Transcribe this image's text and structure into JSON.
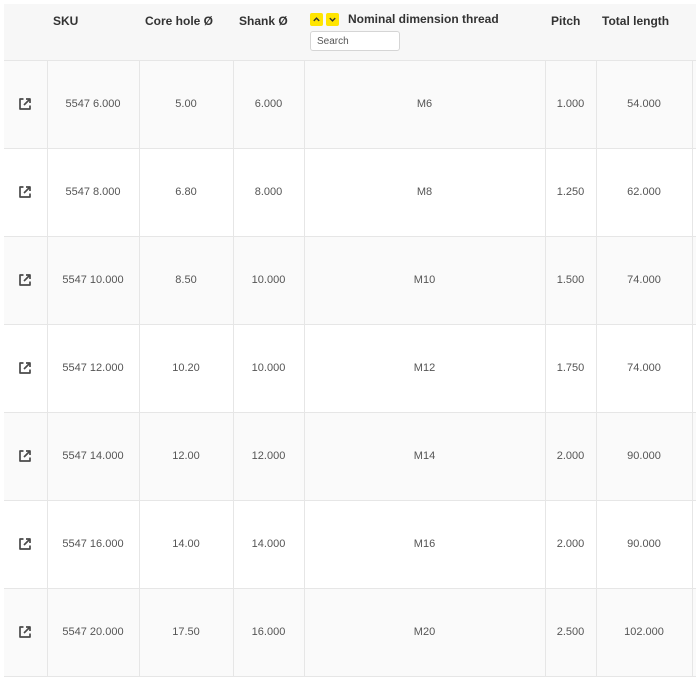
{
  "table": {
    "headers": {
      "sku": "SKU",
      "core_hole": "Core hole Ø",
      "shank": "Shank Ø",
      "nominal": "Nominal dimension thread",
      "pitch": "Pitch",
      "total_length": "Total length"
    },
    "sort_up_icon": "chevron-up-icon",
    "sort_down_icon": "chevron-down-icon",
    "sort_button_color": "#ffe500",
    "search_placeholder": "Search",
    "row_link_icon": "external-link-icon",
    "rows": [
      {
        "sku": "5547 6.000",
        "core_hole": "5.00",
        "shank": "6.000",
        "nominal": "M6",
        "pitch": "1.000",
        "total_length": "54.000"
      },
      {
        "sku": "5547 8.000",
        "core_hole": "6.80",
        "shank": "8.000",
        "nominal": "M8",
        "pitch": "1.250",
        "total_length": "62.000"
      },
      {
        "sku": "5547 10.000",
        "core_hole": "8.50",
        "shank": "10.000",
        "nominal": "M10",
        "pitch": "1.500",
        "total_length": "74.000"
      },
      {
        "sku": "5547 12.000",
        "core_hole": "10.20",
        "shank": "10.000",
        "nominal": "M12",
        "pitch": "1.750",
        "total_length": "74.000"
      },
      {
        "sku": "5547 14.000",
        "core_hole": "12.00",
        "shank": "12.000",
        "nominal": "M14",
        "pitch": "2.000",
        "total_length": "90.000"
      },
      {
        "sku": "5547 16.000",
        "core_hole": "14.00",
        "shank": "14.000",
        "nominal": "M16",
        "pitch": "2.000",
        "total_length": "90.000"
      },
      {
        "sku": "5547 20.000",
        "core_hole": "17.50",
        "shank": "16.000",
        "nominal": "M20",
        "pitch": "2.500",
        "total_length": "102.000"
      }
    ]
  }
}
